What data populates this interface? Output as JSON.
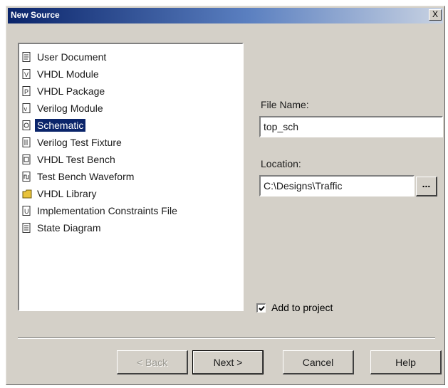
{
  "dialog": {
    "title": "New Source",
    "close_label": "X"
  },
  "source_types": [
    {
      "label": "User Document",
      "icon": "document-icon"
    },
    {
      "label": "VHDL Module",
      "icon": "vhdl-module-icon"
    },
    {
      "label": "VHDL Package",
      "icon": "vhdl-package-icon"
    },
    {
      "label": "Verilog Module",
      "icon": "verilog-module-icon"
    },
    {
      "label": "Schematic",
      "icon": "schematic-icon",
      "selected": true
    },
    {
      "label": "Verilog Test Fixture",
      "icon": "test-fixture-icon"
    },
    {
      "label": "VHDL Test Bench",
      "icon": "test-bench-icon"
    },
    {
      "label": "Test Bench Waveform",
      "icon": "waveform-icon"
    },
    {
      "label": "VHDL Library",
      "icon": "library-folder-icon"
    },
    {
      "label": "Implementation Constraints File",
      "icon": "constraints-file-icon"
    },
    {
      "label": "State Diagram",
      "icon": "state-diagram-icon"
    }
  ],
  "file_name": {
    "label": "File Name:",
    "value": "top_sch"
  },
  "location": {
    "label": "Location:",
    "value": "C:\\Designs\\Traffic",
    "browse_label": "..."
  },
  "add_to_project": {
    "label": "Add to project",
    "checked": true
  },
  "buttons": {
    "back": "< Back",
    "next": "Next >",
    "cancel": "Cancel",
    "help": "Help"
  },
  "colors": {
    "dialog_bg": "#d4d0c8",
    "title_start": "#0a246a",
    "title_end": "#c8d2e2",
    "selection": "#0a246a"
  }
}
